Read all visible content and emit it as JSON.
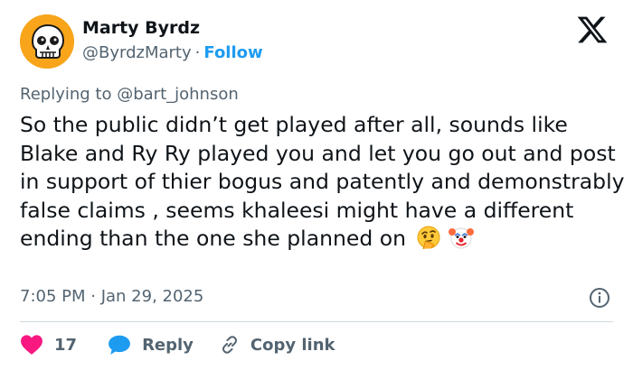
{
  "author": {
    "name": "Marty Byrdz",
    "handle": "@ByrdzMarty",
    "separator": "·",
    "follow_label": "Follow"
  },
  "reply_context": {
    "prefix": "Replying to",
    "mention": "@bart_johnson"
  },
  "tweet": {
    "text": "So the public didn’t get played after all, sounds like Blake and Ry Ry played you and let you go out and post in support of thier bogus and patently and demonstrably false claims , seems khaleesi might have a different ending than the one she planned on",
    "emojis": [
      "thinking-face",
      "clown-face"
    ],
    "timestamp": "7:05 PM · Jan 29, 2025"
  },
  "actions": {
    "like_count": "17",
    "reply_label": "Reply",
    "copy_link_label": "Copy link"
  },
  "colors": {
    "accent": "#1d9bf0",
    "like": "#f91880",
    "reply": "#1d9bf0",
    "muted": "#536471",
    "text": "#0f1419",
    "divider": "#cfd9de",
    "avatar_bg": "#f8a51c"
  },
  "icons": {
    "logo": "x-logo-icon",
    "avatar": "skull-avatar",
    "info": "info-icon",
    "like": "heart-icon",
    "reply": "speech-bubble-icon",
    "copy": "link-icon"
  }
}
